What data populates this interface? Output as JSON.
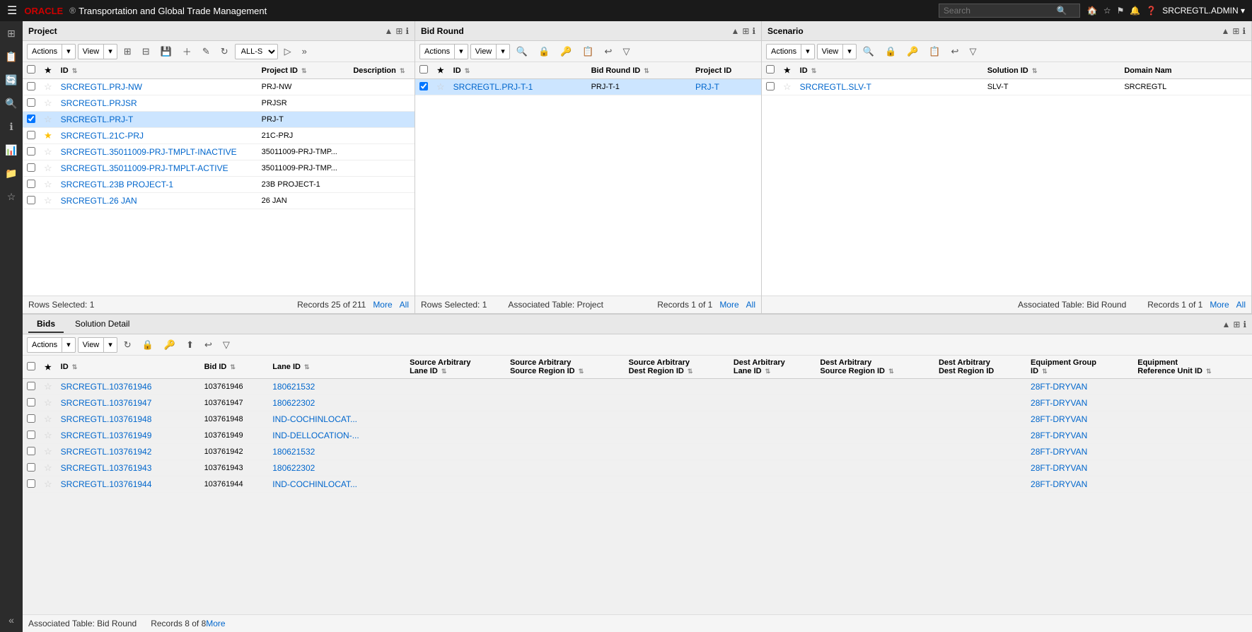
{
  "app": {
    "title": "Transportation and Global Trade Management",
    "logo": "ORACLE"
  },
  "topnav": {
    "search_placeholder": "Search",
    "user": "SRCREGTL.ADMIN ▾"
  },
  "panels": {
    "project": {
      "title": "Project",
      "actions_label": "Actions",
      "view_label": "View",
      "all_s": "ALL-S",
      "columns": [
        "",
        "★",
        "ID",
        "Project ID",
        "Description"
      ],
      "rows": [
        {
          "id": "SRCREGTL.PRJ-NW",
          "project_id": "PRJ-NW",
          "description": "",
          "selected": false,
          "star": false
        },
        {
          "id": "SRCREGTL.PRJSR",
          "project_id": "PRJSR",
          "description": "",
          "selected": false,
          "star": false
        },
        {
          "id": "SRCREGTL.PRJ-T",
          "project_id": "PRJ-T",
          "description": "",
          "selected": true,
          "star": false
        },
        {
          "id": "SRCREGTL.21C-PRJ",
          "project_id": "21C-PRJ",
          "description": "",
          "selected": false,
          "star": true
        },
        {
          "id": "SRCREGTL.35011009-PRJ-TMPLT-INACTIVE",
          "project_id": "35011009-PRJ-TMP...",
          "description": "",
          "selected": false,
          "star": false
        },
        {
          "id": "SRCREGTL.35011009-PRJ-TMPLT-ACTIVE",
          "project_id": "35011009-PRJ-TMP...",
          "description": "",
          "selected": false,
          "star": false
        },
        {
          "id": "SRCREGTL.23B PROJECT-1",
          "project_id": "23B PROJECT-1",
          "description": "",
          "selected": false,
          "star": false
        },
        {
          "id": "SRCREGTL.26 JAN",
          "project_id": "26 JAN",
          "description": "",
          "selected": false,
          "star": false
        }
      ],
      "footer": {
        "rows_selected": "Rows Selected: 1",
        "records": "Records 25 of 211",
        "more": "More",
        "all": "All"
      }
    },
    "bidround": {
      "title": "Bid Round",
      "actions_label": "Actions",
      "view_label": "View",
      "columns": [
        "",
        "★",
        "ID",
        "Bid Round ID",
        "Project ID"
      ],
      "rows": [
        {
          "id": "SRCREGTL.PRJ-T-1",
          "bid_round_id": "PRJ-T-1",
          "project_id": "PRJ-T",
          "selected": true,
          "star": false
        }
      ],
      "footer": {
        "rows_selected": "Rows Selected: 1",
        "assoc_table": "Associated Table: Project",
        "records": "Records 1 of 1",
        "more": "More",
        "all": "All"
      }
    },
    "scenario": {
      "title": "Scenario",
      "actions_label": "Actions",
      "view_label": "View",
      "columns": [
        "",
        "★",
        "ID",
        "Solution ID",
        "Domain Nam"
      ],
      "rows": [
        {
          "id": "SRCREGTL.SLV-T",
          "solution_id": "SLV-T",
          "domain_name": "SRCREGTL",
          "selected": false,
          "star": false
        }
      ],
      "footer": {
        "assoc_table": "Associated Table: Bid Round",
        "records": "Records 1 of 1",
        "more": "More",
        "all": "All"
      }
    }
  },
  "bottom": {
    "tabs": [
      "Bids",
      "Solution Detail"
    ],
    "active_tab": "Bids",
    "actions_label": "Actions",
    "view_label": "View",
    "columns": [
      "",
      "★",
      "ID",
      "Bid ID",
      "Lane ID",
      "Source Arbitrary Lane ID",
      "Source Arbitrary Source Region ID",
      "Source Arbitrary Dest Region ID",
      "Dest Arbitrary Lane ID",
      "Dest Arbitrary Source Region ID",
      "Dest Arbitrary Dest Region ID",
      "Equipment Group ID",
      "Equipment Reference Unit ID"
    ],
    "rows": [
      {
        "id": "SRCREGTL.103761946",
        "bid_id": "103761946",
        "lane_id": "180621532",
        "eq_group": "28FT-DRYVAN"
      },
      {
        "id": "SRCREGTL.103761947",
        "bid_id": "103761947",
        "lane_id": "180622302",
        "eq_group": "28FT-DRYVAN"
      },
      {
        "id": "SRCREGTL.103761948",
        "bid_id": "103761948",
        "lane_id": "IND-COCHINLOCAT...",
        "eq_group": "28FT-DRYVAN"
      },
      {
        "id": "SRCREGTL.103761949",
        "bid_id": "103761949",
        "lane_id": "IND-DELLOCATION-...",
        "eq_group": "28FT-DRYVAN"
      },
      {
        "id": "SRCREGTL.103761942",
        "bid_id": "103761942",
        "lane_id": "180621532",
        "eq_group": "28FT-DRYVAN"
      },
      {
        "id": "SRCREGTL.103761943",
        "bid_id": "103761943",
        "lane_id": "180622302",
        "eq_group": "28FT-DRYVAN"
      },
      {
        "id": "SRCREGTL.103761944",
        "bid_id": "103761944",
        "lane_id": "IND-COCHINLOCAT...",
        "eq_group": "28FT-DRYVAN"
      }
    ],
    "footer": {
      "assoc_table": "Associated Table: Bid Round",
      "records": "Records 8 of 8",
      "more": "More"
    }
  }
}
